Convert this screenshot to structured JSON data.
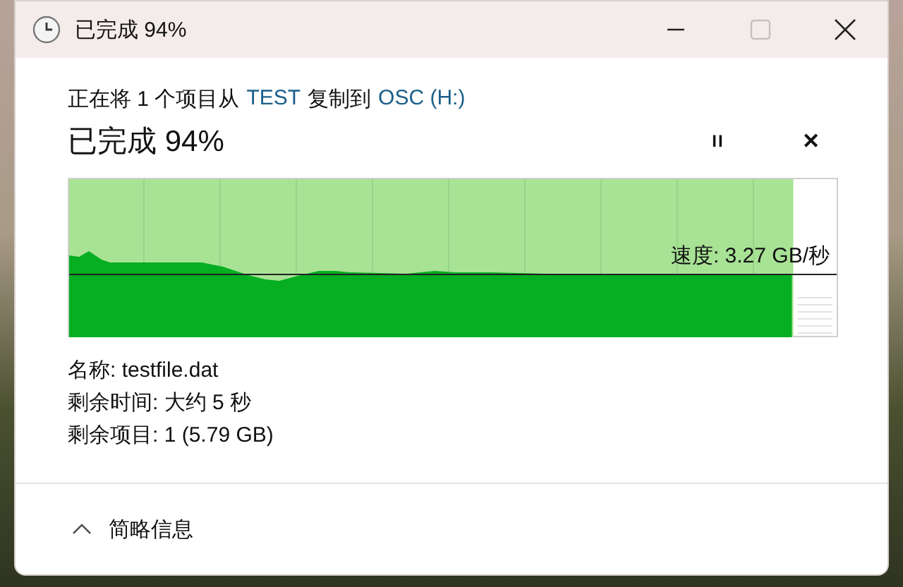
{
  "window": {
    "title": "已完成 94%",
    "buttons": [
      {
        "kind": "minimize",
        "disabled": false
      },
      {
        "kind": "maximize",
        "disabled": true
      },
      {
        "kind": "close",
        "disabled": false
      }
    ]
  },
  "message": {
    "parts": [
      {
        "kind": "text",
        "text": "正在将 1 个项目从"
      },
      {
        "kind": "link",
        "text": "TEST"
      },
      {
        "kind": "text",
        "text": "复制到"
      },
      {
        "kind": "link",
        "text": "OSC (H:)"
      }
    ]
  },
  "headline": "已完成 94%",
  "actions": [
    {
      "kind": "pause",
      "label": "II"
    },
    {
      "kind": "cancel",
      "label": "✕"
    }
  ],
  "graph": {
    "level": 0.94,
    "speed": "速度: 3.27 GB/秒"
  },
  "details": [
    "名称: testfile.dat",
    "剩余时间: 大约 5 秒",
    "剩余项目: 1 (5.79 GB)"
  ],
  "footer": {
    "label": "简略信息",
    "expanded": true
  }
}
